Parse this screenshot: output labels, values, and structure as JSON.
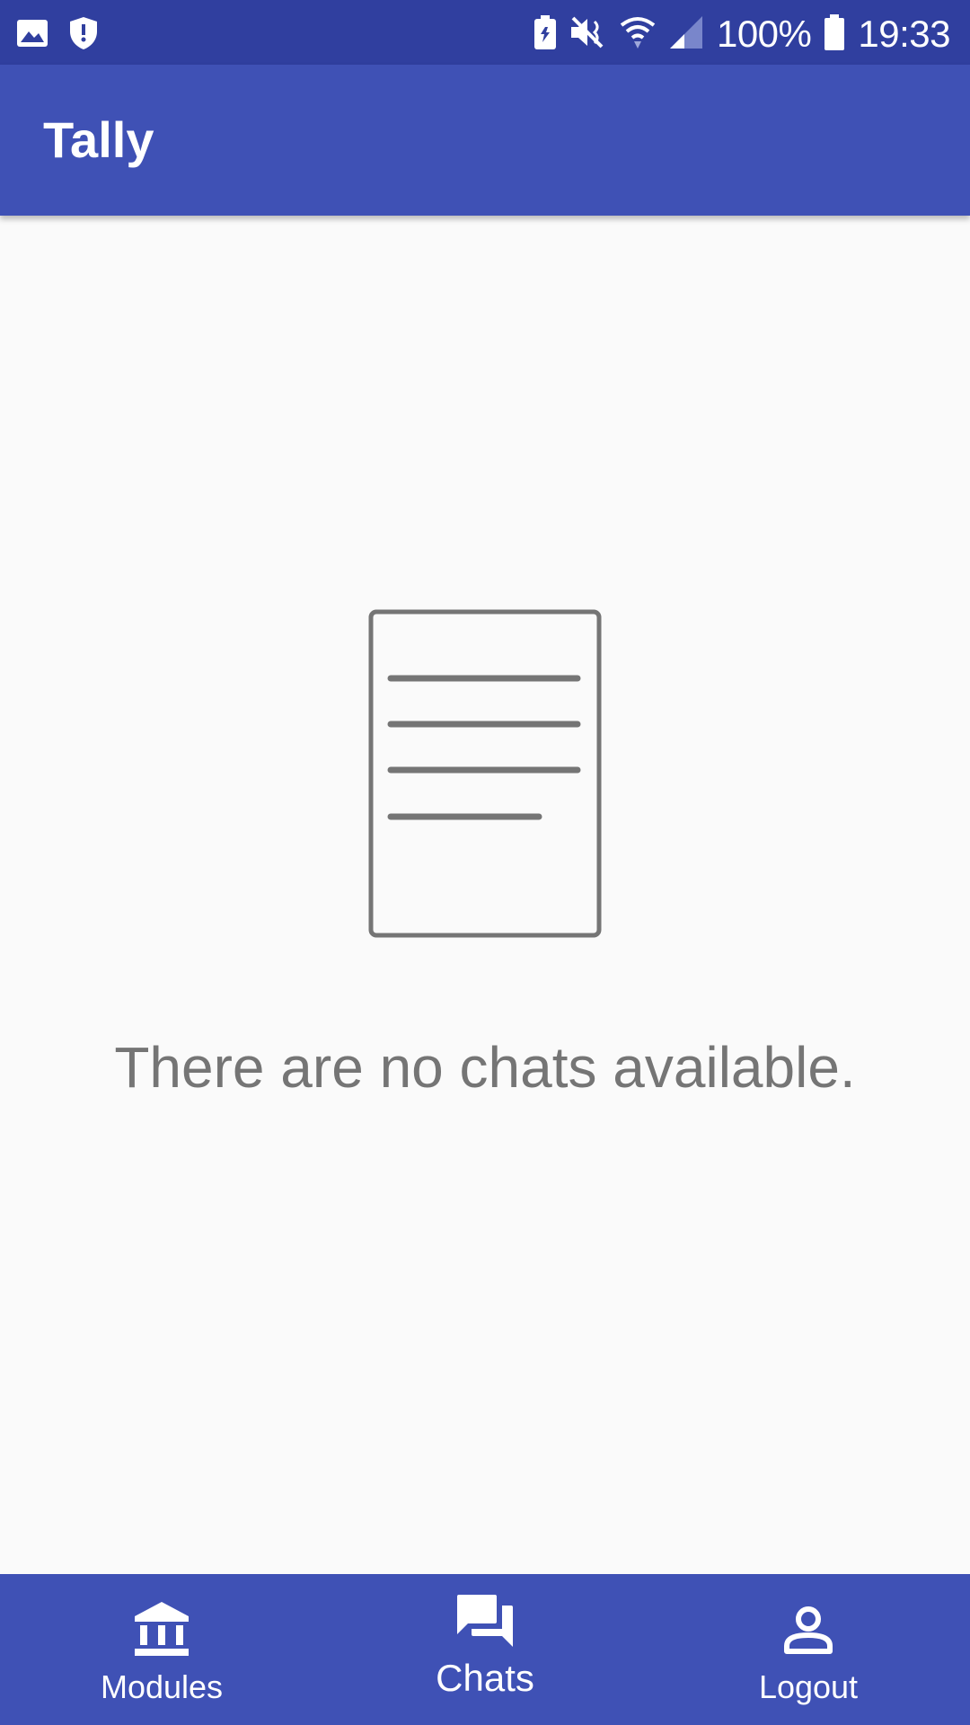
{
  "status_bar": {
    "battery_percent": "100%",
    "time": "19:33",
    "left_icons": [
      "gallery-icon",
      "shield-icon"
    ],
    "right_icons": [
      "battery-saver-icon",
      "mute-icon",
      "wifi-icon",
      "signal-icon",
      "battery-icon"
    ]
  },
  "app_bar": {
    "title": "Tally"
  },
  "empty_state": {
    "icon": "document-icon",
    "message": "There are no chats available."
  },
  "bottom_nav": {
    "items": [
      {
        "label": "Modules",
        "icon": "institution-icon",
        "active": false
      },
      {
        "label": "Chats",
        "icon": "forum-icon",
        "active": true
      },
      {
        "label": "Logout",
        "icon": "person-icon",
        "active": false
      }
    ]
  },
  "colors": {
    "primary": "#3f51b5",
    "primary_dark": "#303f9f",
    "background": "#fafafa",
    "empty_text": "#757575"
  }
}
